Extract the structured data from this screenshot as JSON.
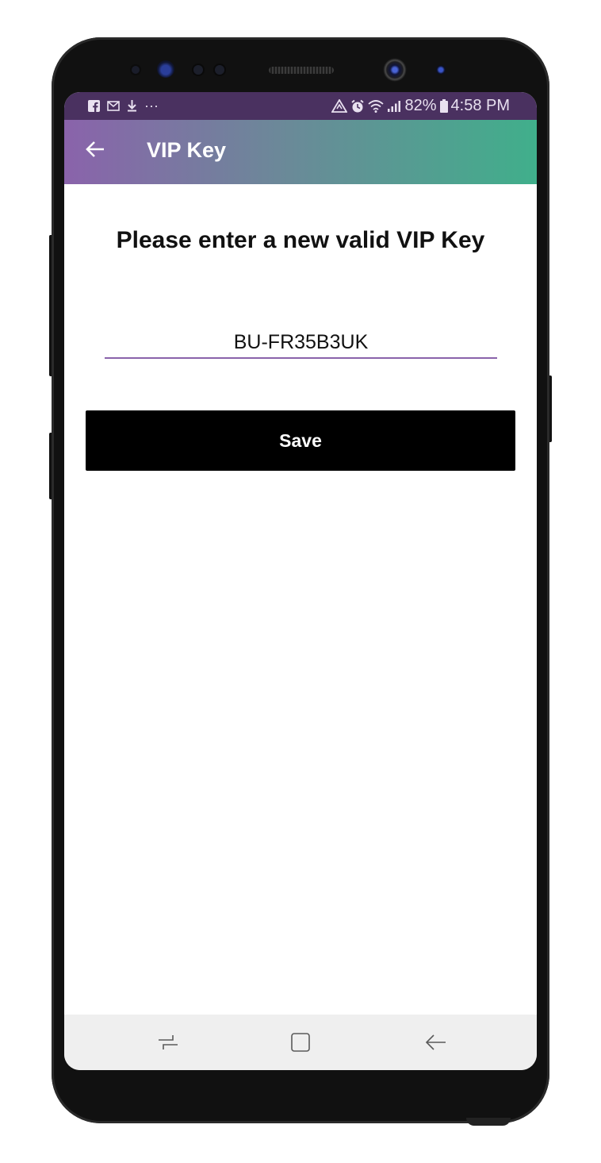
{
  "status_bar": {
    "left_icons": [
      "facebook-icon",
      "mail-icon",
      "download-icon",
      "more-dots-icon"
    ],
    "more_dots": "···",
    "battery_percent": "82%",
    "time": "4:58 PM"
  },
  "app_bar": {
    "back_icon": "arrow-left-icon",
    "title": "VIP Key",
    "gradient": [
      "#8a63ab",
      "#40af8b"
    ]
  },
  "form": {
    "heading": "Please enter a new valid VIP Key",
    "key_value": "BU-FR35B3UK",
    "save_label": "Save"
  },
  "nav_bar": {
    "items": [
      "recent-apps-icon",
      "home-icon",
      "back-icon"
    ]
  },
  "colors": {
    "status_bar": "#4a3160",
    "accent": "#8a63ab",
    "button": "#000000"
  }
}
